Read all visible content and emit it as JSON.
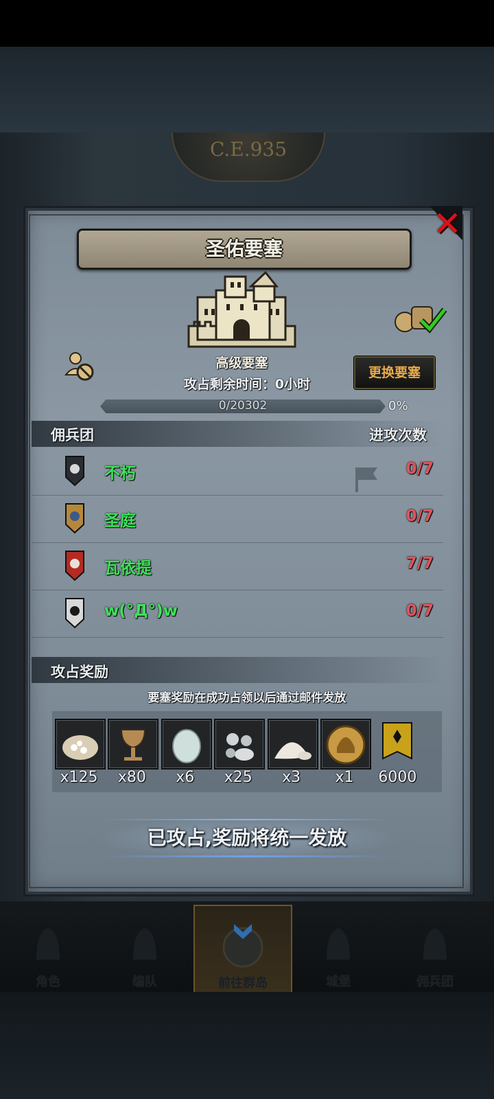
{
  "era_label": "C.E.935",
  "title": "圣佑要塞",
  "fortress": {
    "level_name": "高级要塞",
    "change_button": "更换要塞",
    "remaining_time": "攻占剩余时间：0小时",
    "progress_text": "0/20302",
    "progress_percent": "0%",
    "progress_fraction": 0
  },
  "mercenary_section": {
    "header_left": "佣兵团",
    "header_right": "进攻次数",
    "groups": [
      {
        "name": "不朽",
        "count": "0/7",
        "shield_color": "#2a2e33",
        "emblem_color": "#d9d9d9"
      },
      {
        "name": "圣庭",
        "count": "0/7",
        "shield_color": "#b6873a",
        "emblem_color": "#3b5b86"
      },
      {
        "name": "瓦依提",
        "count": "7/7",
        "shield_color": "#b52a22",
        "emblem_color": "#e7e1d5"
      },
      {
        "name": "w(°Д°)w",
        "count": "0/7",
        "shield_color": "#d8d8d8",
        "emblem_color": "#1a1a1a"
      }
    ]
  },
  "reward_section": {
    "header": "攻占奖励",
    "note": "要塞奖励在成功占领以后通过邮件发放",
    "items": [
      {
        "icon": "grain-sack-icon",
        "qty": "x125"
      },
      {
        "icon": "goblet-icon",
        "qty": "x80"
      },
      {
        "icon": "pearl-icon",
        "qty": "x6"
      },
      {
        "icon": "silver-ore-icon",
        "qty": "x25"
      },
      {
        "icon": "salt-pile-icon",
        "qty": "x3"
      },
      {
        "icon": "helmet-medal-icon",
        "qty": "x1"
      },
      {
        "icon": "banner-badge-icon",
        "qty": "6000"
      }
    ],
    "captured_text": "已攻占,奖励将统一发放"
  },
  "nav": [
    {
      "label": "角色",
      "icon": "knight-icon"
    },
    {
      "label": "编队",
      "icon": "formation-icon"
    },
    {
      "label": "前往群岛",
      "icon": "islands-icon",
      "active": true
    },
    {
      "label": "城堡",
      "icon": "castle-icon"
    },
    {
      "label": "佣兵团",
      "icon": "mercenary-icon"
    }
  ],
  "colors": {
    "group_name": "#3fe05b",
    "count": "#e05359",
    "button_text": "#e8a94b",
    "close": "#d8121a"
  }
}
